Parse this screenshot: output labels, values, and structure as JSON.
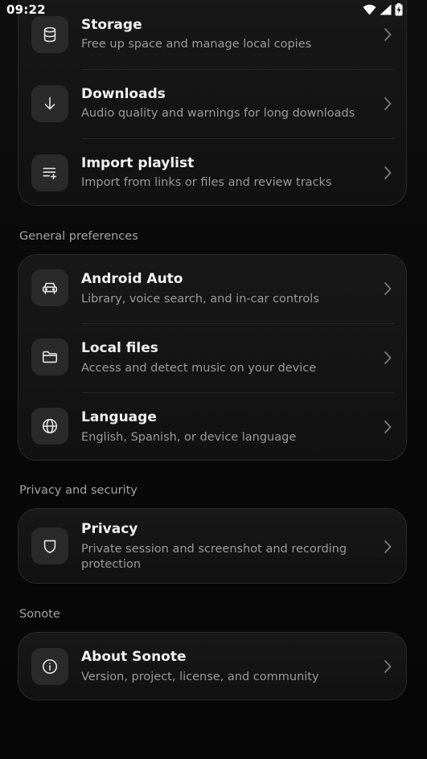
{
  "status_bar": {
    "time": "09:22",
    "icons": [
      "wifi-icon",
      "signal-icon",
      "battery-charging-icon"
    ]
  },
  "sections": [
    {
      "label": "",
      "items": [
        {
          "icon": "database-icon",
          "title": "Storage",
          "subtitle": "Free up space and manage local copies"
        },
        {
          "icon": "download-arrow-icon",
          "title": "Downloads",
          "subtitle": "Audio quality and warnings for long downloads"
        },
        {
          "icon": "playlist-add-icon",
          "title": "Import playlist",
          "subtitle": "Import from links or files and review tracks"
        }
      ]
    },
    {
      "label": "General preferences",
      "items": [
        {
          "icon": "car-icon",
          "title": "Android Auto",
          "subtitle": "Library, voice search, and in-car controls"
        },
        {
          "icon": "folder-icon",
          "title": "Local files",
          "subtitle": "Access and detect music on your device"
        },
        {
          "icon": "globe-icon",
          "title": "Language",
          "subtitle": "English, Spanish, or device language"
        }
      ]
    },
    {
      "label": "Privacy and security",
      "items": [
        {
          "icon": "shield-icon",
          "title": "Privacy",
          "subtitle": "Private session and screenshot and recording protection"
        }
      ]
    },
    {
      "label": "Sonote",
      "items": [
        {
          "icon": "info-icon",
          "title": "About Sonote",
          "subtitle": "Version, project, license, and community"
        }
      ]
    }
  ]
}
